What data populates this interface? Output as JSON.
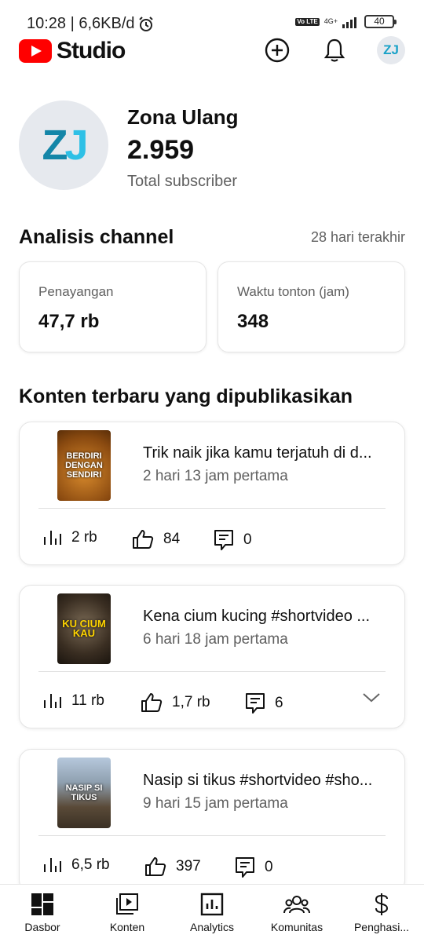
{
  "status_bar": {
    "time_data": "10:28 | 6,6KB/d",
    "volte": "Vo LTE",
    "network": "4G+",
    "battery": "40"
  },
  "app": {
    "brand": "Studio"
  },
  "channel": {
    "initials": "ZJ",
    "name": "Zona Ulang",
    "subscribers": "2.959",
    "subscribers_label": "Total subscriber"
  },
  "analytics": {
    "title": "Analisis channel",
    "range": "28 hari terakhir",
    "views_label": "Penayangan",
    "views_value": "47,7 rb",
    "watch_label": "Waktu tonton (jam)",
    "watch_value": "348"
  },
  "recent": {
    "title": "Konten terbaru yang dipublikasikan",
    "videos": [
      {
        "title": "Trik naik jika kamu terjatuh di d...",
        "time": "2 hari 13 jam pertama",
        "thumb_text": "BERDIRI DENGAN SENDIRI",
        "views": "2 rb",
        "likes": "84",
        "comments": "0"
      },
      {
        "title": "Kena cium kucing #shortvideo ...",
        "time": "6 hari 18 jam pertama",
        "thumb_text": "KU CIUM KAU",
        "views": "11 rb",
        "likes": "1,7 rb",
        "comments": "6"
      },
      {
        "title": "Nasip si tikus #shortvideo #sho...",
        "time": "9 hari 15 jam pertama",
        "thumb_text": "NASIP SI TIKUS",
        "views": "6,5 rb",
        "likes": "397",
        "comments": "0"
      }
    ]
  },
  "nav": {
    "items": [
      {
        "label": "Dasbor"
      },
      {
        "label": "Konten"
      },
      {
        "label": "Analytics"
      },
      {
        "label": "Komunitas"
      },
      {
        "label": "Penghasi..."
      }
    ]
  },
  "colors": {
    "brand_red": "#ff0000",
    "logo_dark": "#1486a8",
    "logo_light": "#2ec0e6",
    "secondary_text": "#606060"
  }
}
